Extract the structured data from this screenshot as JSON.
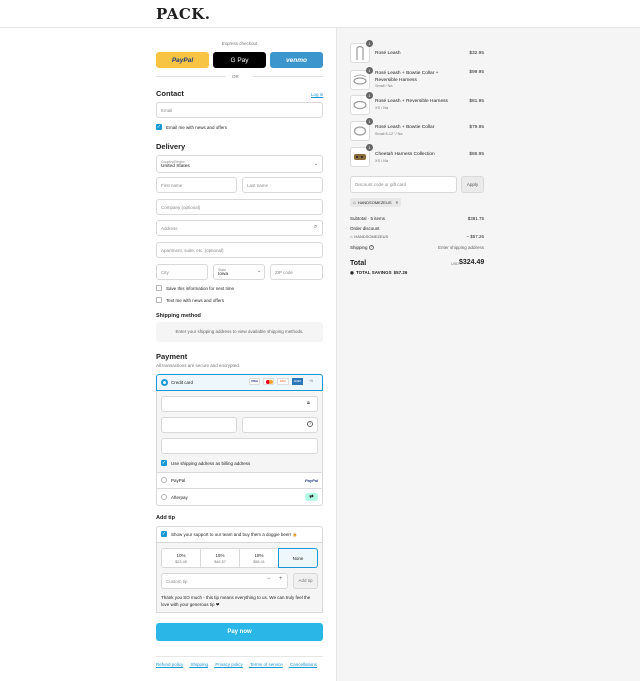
{
  "brand": {
    "logo": "PACK."
  },
  "express": {
    "label": "Express checkout",
    "paypal": "PayPal",
    "gpay": "G Pay",
    "venmo": "venmo",
    "or": "OR"
  },
  "contact": {
    "title": "Contact",
    "login": "Log in",
    "email_placeholder": "Email",
    "news_label": "Email me with news and offers"
  },
  "delivery": {
    "title": "Delivery",
    "country_label": "Country/Region",
    "country_value": "United States",
    "first_name": "First name",
    "last_name": "Last name",
    "company": "Company (optional)",
    "address": "Address",
    "apartment": "Apartment, suite, etc. (optional)",
    "city": "City",
    "state_label": "State",
    "state_value": "Iowa",
    "zip": "ZIP code",
    "save_info": "Save this information for next time",
    "text_me": "Text me with news and offers"
  },
  "shipping": {
    "title": "Shipping method",
    "note": "Enter your shipping address to view available shipping methods."
  },
  "payment": {
    "title": "Payment",
    "secure": "All transactions are secure and encrypted.",
    "credit_card": "Credit card",
    "card_icons": [
      "VISA",
      "MC",
      "DISC",
      "AMEX",
      "+5"
    ],
    "billing_same": "Use shipping address as billing address",
    "paypal": "PayPal",
    "paypal_logo": "PayPal",
    "afterpay": "Afterpay"
  },
  "tip": {
    "title": "Add tip",
    "support_label": "Show your support to our team and buy them a doggie beer! 🍺",
    "options": [
      {
        "pct": "10%",
        "amount": "$23.45"
      },
      {
        "pct": "15%",
        "amount": "$46.57"
      },
      {
        "pct": "18%",
        "amount": "$58.41"
      },
      {
        "pct": "None",
        "amount": ""
      }
    ],
    "custom_placeholder": "Custom tip",
    "add_tip": "Add tip",
    "thanks": "Thank you SO much - this tip means everything to us. We can truly feel the love with your generous tip ❤"
  },
  "pay_now": "Pay now",
  "footer": [
    "Refund policy",
    "Shipping",
    "Privacy policy",
    "Terms of service",
    "Cancellations"
  ],
  "cart": {
    "items": [
      {
        "qty": "1",
        "name": "Rosé Leash",
        "sub": "",
        "price": "$32.95"
      },
      {
        "qty": "1",
        "name": "Rosé Leash + Bowtie Collar + Reversible Harness",
        "sub": "Small / Na",
        "price": "$99.95"
      },
      {
        "qty": "1",
        "name": "Rosé Leash + Reversible Harness",
        "sub": "XS / Na",
        "price": "$81.95"
      },
      {
        "qty": "1",
        "name": "Rosé Leash + Bowtie Collar",
        "sub": "Small 8-12\" / Na",
        "price": "$79.95"
      },
      {
        "qty": "1",
        "name": "Cheetah Harness Collection",
        "sub": "XS / Na",
        "price": "$86.95"
      }
    ],
    "discount_placeholder": "Discount code or gift card",
    "apply": "Apply",
    "code_chip": "HANDSOMEZEUS",
    "subtotal_label": "Subtotal · 5 items",
    "subtotal_value": "$381.75",
    "order_discount_label": "Order discount",
    "discount_code": "HANDSOMEZEUS",
    "discount_value": "− $57.26",
    "shipping_label": "Shipping",
    "shipping_value": "Enter shipping address",
    "total_label": "Total",
    "currency": "USD",
    "total_value": "$324.49",
    "savings_label": "TOTAL SAVINGS",
    "savings_value": "$57.26"
  },
  "colors": {
    "accent": "#1a98d5",
    "paypal_yellow": "#f7c443",
    "venmo_blue": "#3d95ce"
  }
}
